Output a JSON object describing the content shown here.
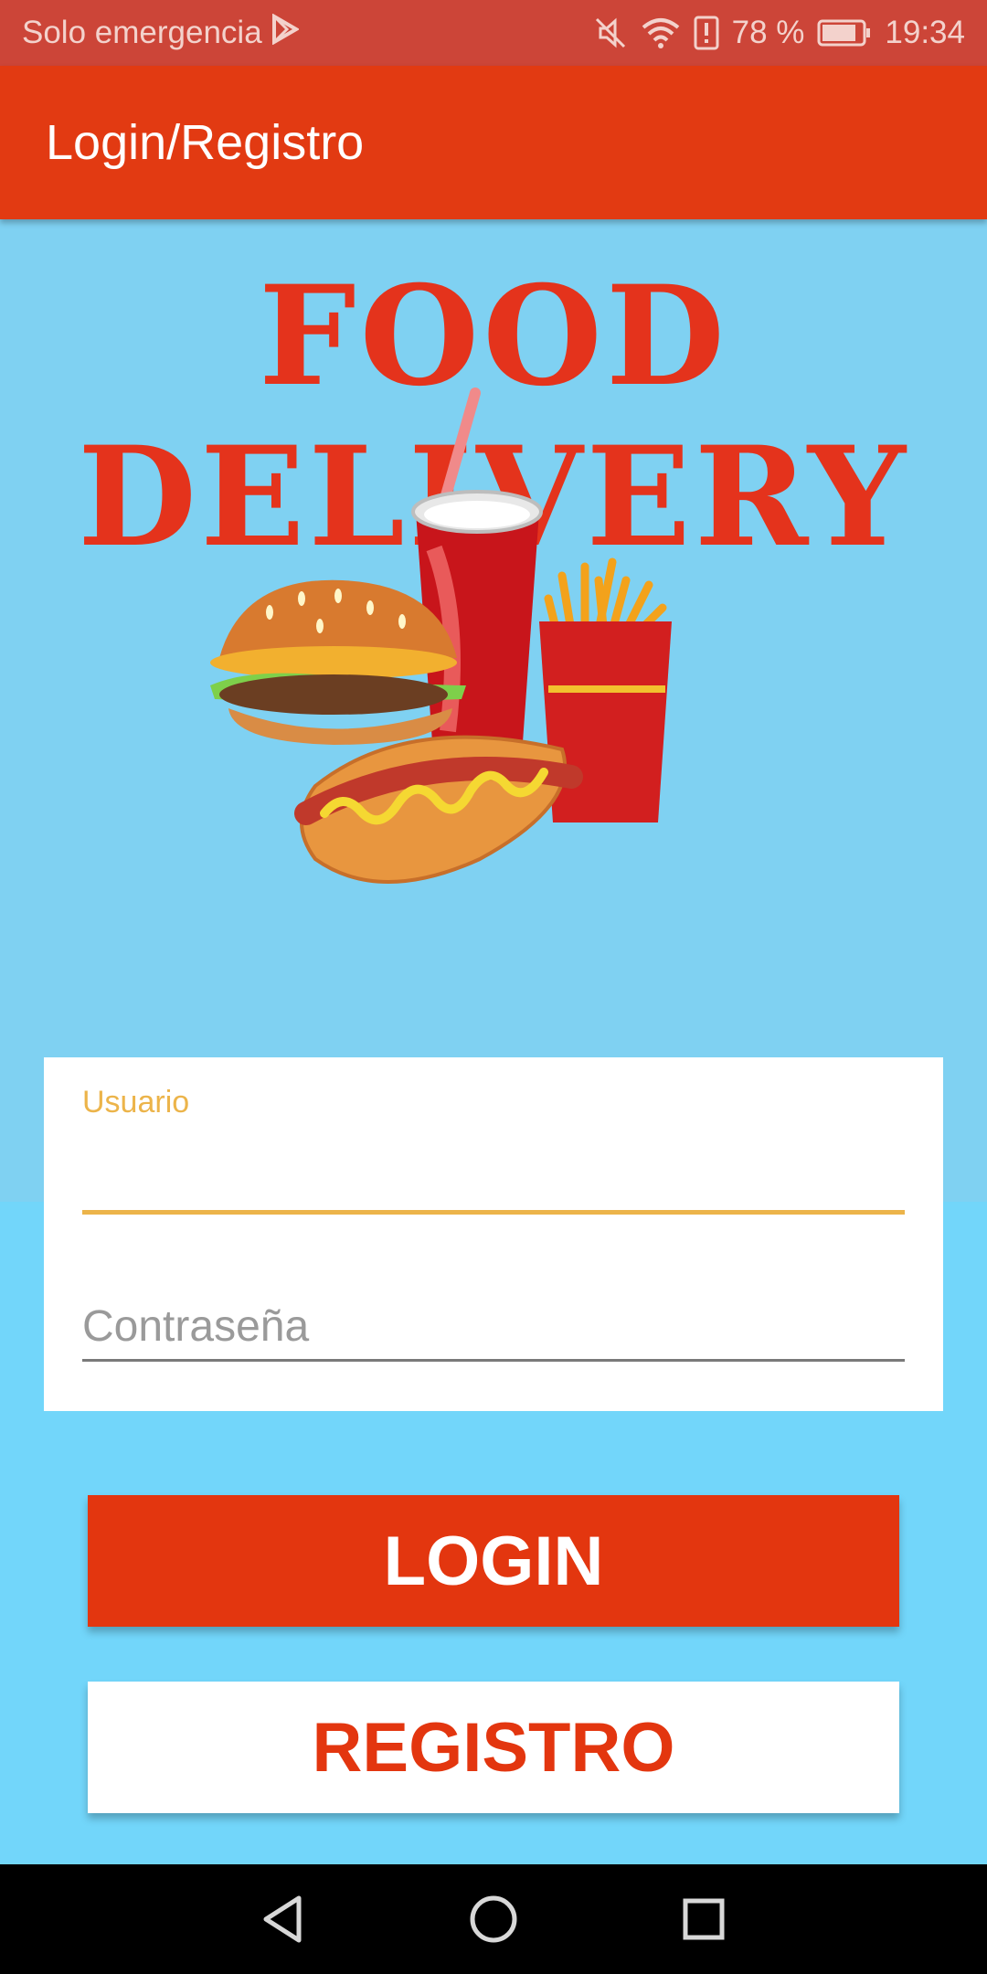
{
  "status_bar": {
    "carrier": "Solo emergencia",
    "battery": "78 %",
    "time": "19:34",
    "icons": [
      "play-store-icon",
      "mute-icon",
      "wifi-icon",
      "alert-icon",
      "battery-icon"
    ]
  },
  "app_bar": {
    "title": "Login/Registro"
  },
  "hero": {
    "brand_title": "FOOD DELIVERY",
    "illustration": "fast-food-illustration"
  },
  "form": {
    "username": {
      "label": "Usuario",
      "value": ""
    },
    "password": {
      "placeholder": "Contraseña",
      "value": ""
    }
  },
  "buttons": {
    "login": "LOGIN",
    "register": "REGISTRO"
  },
  "nav_bar": {
    "icons": [
      "back-icon",
      "home-icon",
      "recents-icon"
    ]
  },
  "colors": {
    "status_bar": "#cc4538",
    "app_bar": "#e23a12",
    "hero_bg": "#7fd1f2",
    "page_bg": "#72d6fa",
    "accent_yellow": "#ecb44a",
    "primary_red": "#e3360f"
  }
}
